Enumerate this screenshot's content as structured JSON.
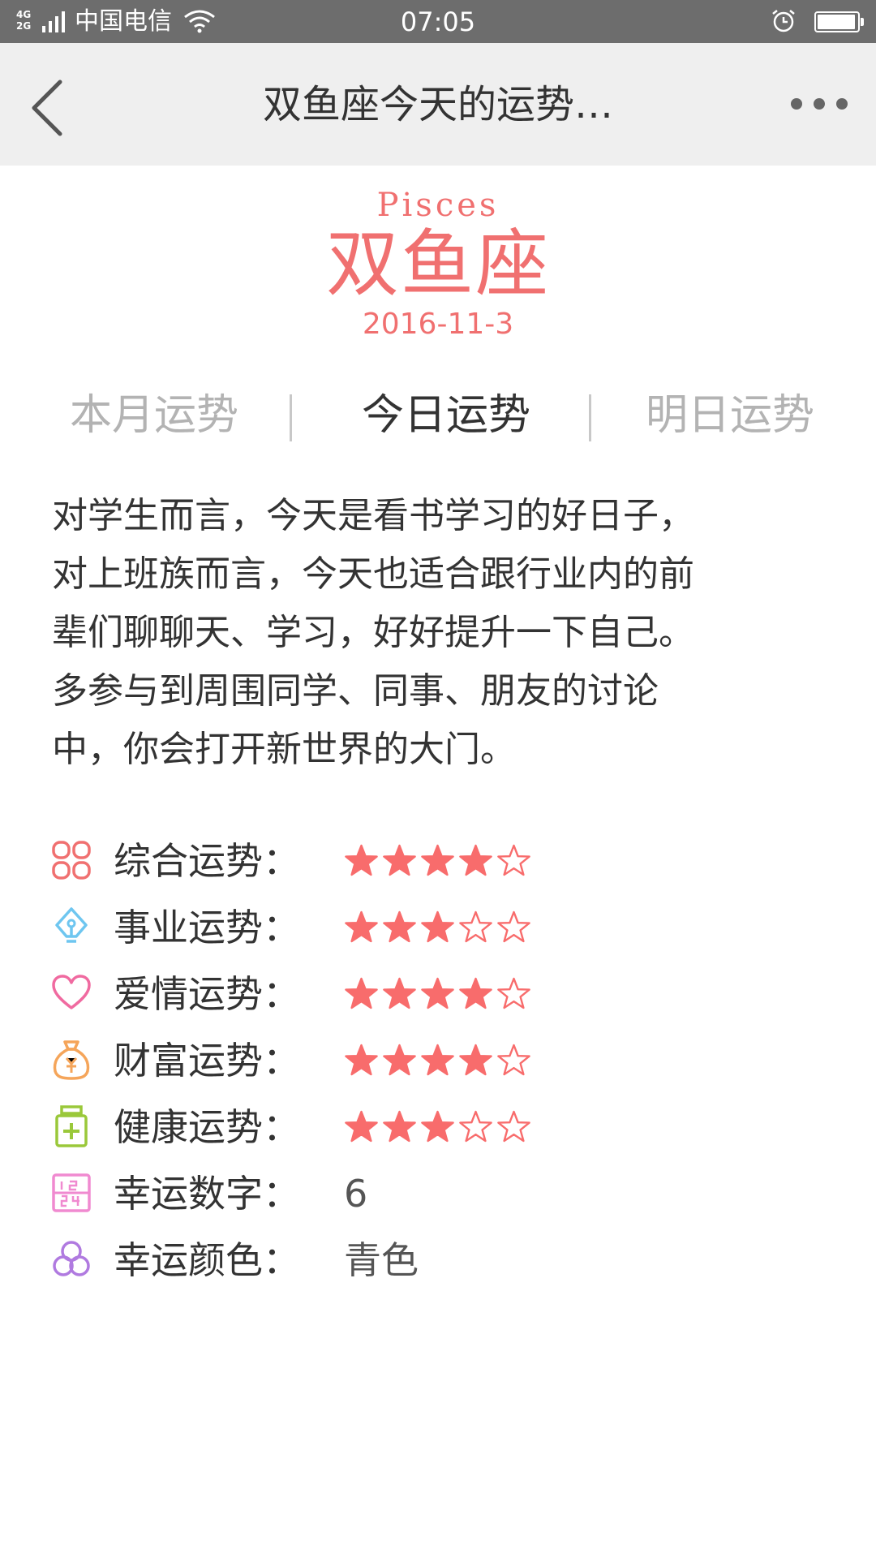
{
  "status_bar": {
    "network_top": "4G",
    "network_bottom": "2G",
    "carrier": "中国电信",
    "time": "07:05",
    "battery_level": 0.95
  },
  "header": {
    "title": "双鱼座今天的运势…"
  },
  "sign": {
    "name_en": "Pisces",
    "name_cn": "双鱼座",
    "date": "2016-11-3"
  },
  "tabs": [
    {
      "label": "本月运势",
      "active": false
    },
    {
      "label": "今日运势",
      "active": true
    },
    {
      "label": "明日运势",
      "active": false
    }
  ],
  "description": [
    "对学生而言，今天是看书学习的好日子，",
    "对上班族而言，今天也适合跟行业内的前",
    "辈们聊聊天、学习，好好提升一下自己。",
    "多参与到周围同学、同事、朋友的讨论",
    "中，你会打开新世界的大门。"
  ],
  "fortunes": [
    {
      "icon": "overall-grid-icon",
      "label": "综合运势：",
      "stars": 4,
      "max": 5,
      "color": "#f07070"
    },
    {
      "icon": "career-pen-icon",
      "label": "事业运势：",
      "stars": 3,
      "max": 5,
      "color": "#6ec6f0"
    },
    {
      "icon": "love-heart-icon",
      "label": "爱情运势：",
      "stars": 4,
      "max": 5,
      "color": "#f06aa0"
    },
    {
      "icon": "wealth-moneybag-icon",
      "label": "财富运势：",
      "stars": 4,
      "max": 5,
      "color": "#f5a55a"
    },
    {
      "icon": "health-medicine-icon",
      "label": "健康运势：",
      "stars": 3,
      "max": 5,
      "color": "#9ac83a"
    }
  ],
  "lucky": [
    {
      "icon": "lucky-number-icon",
      "label": "幸运数字：",
      "value": "6",
      "color": "#f08ad0"
    },
    {
      "icon": "lucky-color-icon",
      "label": "幸运颜色：",
      "value": "青色",
      "color": "#b07ae0"
    }
  ],
  "colors": {
    "accent": "#f07070",
    "star": "#f86c6c"
  }
}
